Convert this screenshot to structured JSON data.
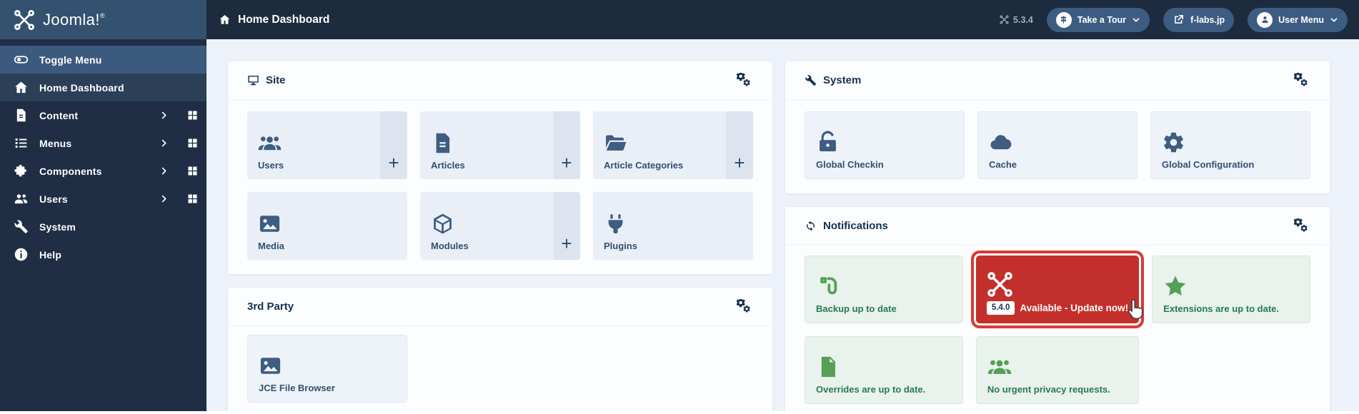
{
  "topbar": {
    "brand": "Joomla!",
    "brand_reg": "®",
    "brand_icon": "joomla",
    "title": "Home Dashboard",
    "title_icon": "home",
    "version": "5.3.4",
    "version_icon": "joomla",
    "actions": [
      {
        "label": "Take a Tour",
        "icon": "signpost",
        "circle": true,
        "chevron": true
      },
      {
        "label": "f-labs.jp",
        "icon": "external-link",
        "circle": false,
        "chevron": false
      },
      {
        "label": "User Menu",
        "icon": "person",
        "circle": true,
        "chevron": true
      }
    ]
  },
  "sidebar": {
    "items": [
      {
        "label": "Toggle Menu",
        "icon": "toggle",
        "state": "hilite"
      },
      {
        "label": "Home Dashboard",
        "icon": "home",
        "state": "active"
      },
      {
        "label": "Content",
        "icon": "file-text",
        "chevron": true,
        "grid": true
      },
      {
        "label": "Menus",
        "icon": "list",
        "chevron": true,
        "grid": true
      },
      {
        "label": "Components",
        "icon": "puzzle",
        "chevron": true,
        "grid": true
      },
      {
        "label": "Users",
        "icon": "users",
        "chevron": true,
        "grid": true
      },
      {
        "label": "System",
        "icon": "wrench"
      },
      {
        "label": "Help",
        "icon": "info"
      }
    ]
  },
  "panels": {
    "site": {
      "title": "Site",
      "icon": "desktop",
      "tiles": [
        {
          "label": "Users",
          "icon": "group",
          "add": true
        },
        {
          "label": "Articles",
          "icon": "file-text",
          "add": true
        },
        {
          "label": "Article Categories",
          "icon": "folder-open",
          "add": true
        },
        {
          "label": "Media",
          "icon": "image",
          "add": false
        },
        {
          "label": "Modules",
          "icon": "cube",
          "add": true
        },
        {
          "label": "Plugins",
          "icon": "plug",
          "add": false
        }
      ]
    },
    "third_party": {
      "title": "3rd Party",
      "icon": null,
      "tiles": [
        {
          "label": "JCE File Browser",
          "icon": "image",
          "style": "system"
        }
      ]
    },
    "system": {
      "title": "System",
      "icon": "wrench",
      "tiles": [
        {
          "label": "Global Checkin",
          "icon": "unlock",
          "style": "system"
        },
        {
          "label": "Cache",
          "icon": "cloud",
          "style": "system"
        },
        {
          "label": "Global Configuration",
          "icon": "gear",
          "style": "system"
        }
      ]
    },
    "notifications": {
      "title": "Notifications",
      "icon": "sync",
      "tiles": [
        {
          "label": "Backup up to date",
          "icon": "backup",
          "style": "success"
        },
        {
          "label": "Available - Update now!",
          "badge": "5.4.0",
          "icon": "joomla",
          "style": "danger",
          "cursor": true
        },
        {
          "label": "Extensions are up to date.",
          "icon": "star",
          "style": "success"
        },
        {
          "label": "Overrides are up to date.",
          "icon": "file",
          "style": "success"
        },
        {
          "label": "No urgent privacy requests.",
          "icon": "group",
          "style": "success"
        }
      ]
    }
  },
  "colors": {
    "topbar_left": "#34516f",
    "topbar_right": "#1c2b3e",
    "sidebar": "#1f2e44",
    "sidebar_hilite": "#3c5a7e",
    "main_bg": "#edf1f9",
    "tile_bg": "#e9eef7",
    "tile_icon": "#3e5d80",
    "success_bg": "#e9f2ec",
    "success_text": "#26795a",
    "success_icon": "#55a056",
    "danger_bg": "#c3302b",
    "danger_ring": "#d93a33",
    "pill_bg": "#3d5c82"
  }
}
